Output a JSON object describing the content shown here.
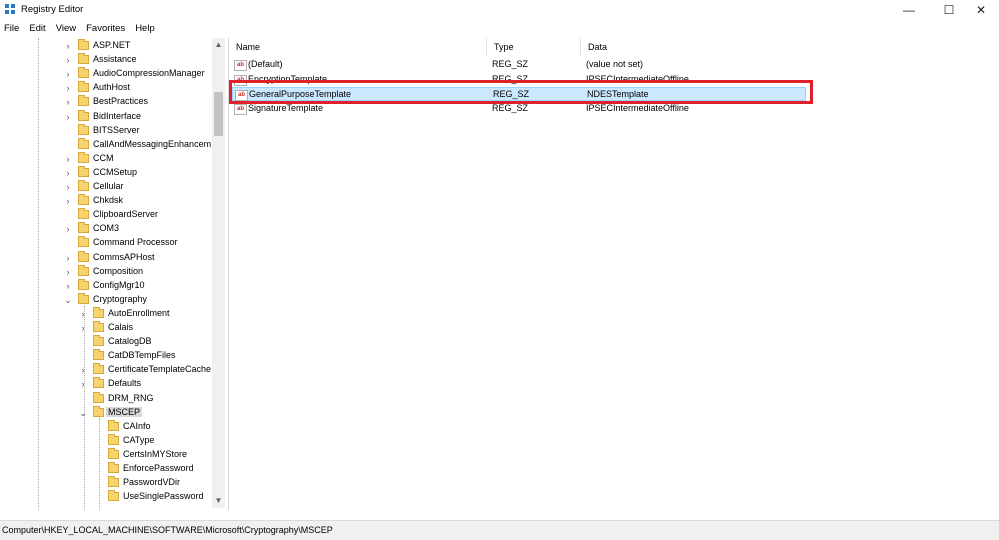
{
  "window": {
    "title": "Registry Editor",
    "minimize": "—",
    "maximize": "☐",
    "close": "✕"
  },
  "menu": [
    "File",
    "Edit",
    "View",
    "Favorites",
    "Help"
  ],
  "tree": [
    {
      "label": "ASP.NET",
      "level": 0,
      "expander": "collapsed"
    },
    {
      "label": "Assistance",
      "level": 0,
      "expander": "collapsed"
    },
    {
      "label": "AudioCompressionManager",
      "level": 0,
      "expander": "collapsed"
    },
    {
      "label": "AuthHost",
      "level": 0,
      "expander": "collapsed"
    },
    {
      "label": "BestPractices",
      "level": 0,
      "expander": "collapsed"
    },
    {
      "label": "BidInterface",
      "level": 0,
      "expander": "collapsed"
    },
    {
      "label": "BITSServer",
      "level": 0,
      "expander": "none"
    },
    {
      "label": "CallAndMessagingEnhancem",
      "level": 0,
      "expander": "none"
    },
    {
      "label": "CCM",
      "level": 0,
      "expander": "collapsed"
    },
    {
      "label": "CCMSetup",
      "level": 0,
      "expander": "collapsed"
    },
    {
      "label": "Cellular",
      "level": 0,
      "expander": "collapsed"
    },
    {
      "label": "Chkdsk",
      "level": 0,
      "expander": "collapsed"
    },
    {
      "label": "ClipboardServer",
      "level": 0,
      "expander": "none"
    },
    {
      "label": "COM3",
      "level": 0,
      "expander": "collapsed"
    },
    {
      "label": "Command Processor",
      "level": 0,
      "expander": "none"
    },
    {
      "label": "CommsAPHost",
      "level": 0,
      "expander": "collapsed"
    },
    {
      "label": "Composition",
      "level": 0,
      "expander": "collapsed"
    },
    {
      "label": "ConfigMgr10",
      "level": 0,
      "expander": "collapsed"
    },
    {
      "label": "Cryptography",
      "level": 0,
      "expander": "expanded"
    },
    {
      "label": "AutoEnrollment",
      "level": 1,
      "expander": "collapsed"
    },
    {
      "label": "Calais",
      "level": 1,
      "expander": "collapsed"
    },
    {
      "label": "CatalogDB",
      "level": 1,
      "expander": "none"
    },
    {
      "label": "CatDBTempFiles",
      "level": 1,
      "expander": "none"
    },
    {
      "label": "CertificateTemplateCache",
      "level": 1,
      "expander": "collapsed"
    },
    {
      "label": "Defaults",
      "level": 1,
      "expander": "collapsed"
    },
    {
      "label": "DRM_RNG",
      "level": 1,
      "expander": "none"
    },
    {
      "label": "MSCEP",
      "level": 1,
      "expander": "expanded",
      "selected": true
    },
    {
      "label": "CAInfo",
      "level": 2,
      "expander": "none"
    },
    {
      "label": "CAType",
      "level": 2,
      "expander": "none"
    },
    {
      "label": "CertsInMYStore",
      "level": 2,
      "expander": "none"
    },
    {
      "label": "EnforcePassword",
      "level": 2,
      "expander": "none"
    },
    {
      "label": "PasswordVDir",
      "level": 2,
      "expander": "none"
    },
    {
      "label": "UseSinglePassword",
      "level": 2,
      "expander": "none"
    }
  ],
  "columns": [
    "Name",
    "Type",
    "Data"
  ],
  "values": [
    {
      "name": "(Default)",
      "type": "REG_SZ",
      "data": "(value not set)"
    },
    {
      "name": "EncryptionTemplate",
      "type": "REG_SZ",
      "data": "IPSECIntermediateOffline"
    },
    {
      "name": "GeneralPurposeTemplate",
      "type": "REG_SZ",
      "data": "NDESTemplate",
      "selected": true
    },
    {
      "name": "SignatureTemplate",
      "type": "REG_SZ",
      "data": "IPSECIntermediateOffline"
    }
  ],
  "icons": {
    "value_icon_text": "ab"
  },
  "status": "Computer\\HKEY_LOCAL_MACHINE\\SOFTWARE\\Microsoft\\Cryptography\\MSCEP",
  "colors": {
    "highlight_border": "#e0202a",
    "selection": "#cce8ff",
    "folder": "#f6d36c"
  }
}
